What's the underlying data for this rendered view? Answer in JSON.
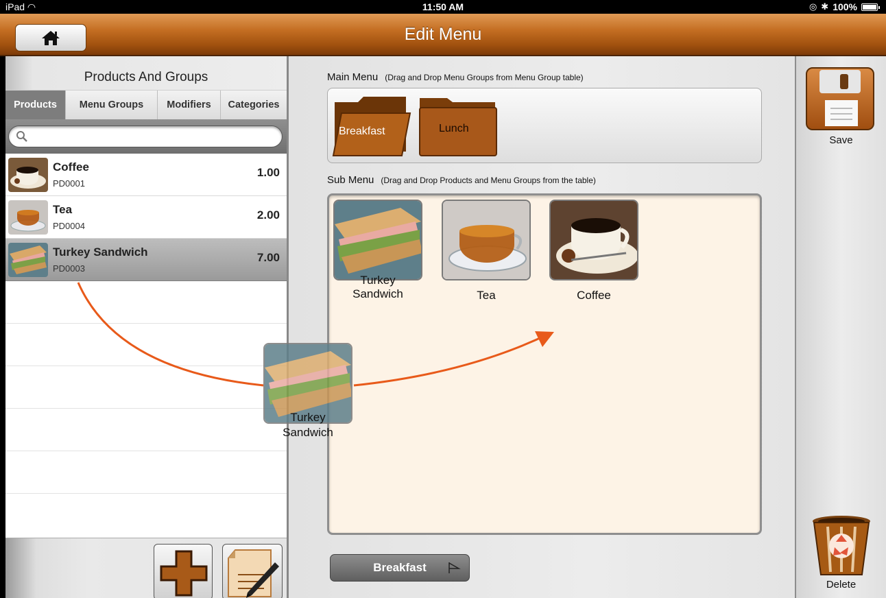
{
  "status_bar": {
    "device": "iPad",
    "time": "11:50 AM",
    "battery": "100%"
  },
  "header": {
    "title": "Edit Menu"
  },
  "left_panel": {
    "title": "Products And Groups",
    "tabs": [
      {
        "label": "Products",
        "active": true
      },
      {
        "label": "Menu Groups",
        "active": false
      },
      {
        "label": "Modifiers",
        "active": false
      },
      {
        "label": "Categories",
        "active": false
      }
    ],
    "search": {
      "placeholder": "",
      "value": ""
    },
    "products": [
      {
        "name": "Coffee",
        "code": "PD0001",
        "price": "1.00",
        "icon": "coffee-image"
      },
      {
        "name": "Tea",
        "code": "PD0004",
        "price": "2.00",
        "icon": "tea-image"
      },
      {
        "name": "Turkey Sandwich",
        "code": "PD0003",
        "price": "7.00",
        "icon": "sandwich-image",
        "selected": true
      }
    ]
  },
  "main_menu": {
    "label": "Main Menu",
    "hint": "(Drag and Drop Menu Groups from Menu Group table)",
    "groups": [
      {
        "label": "Breakfast",
        "open": true
      },
      {
        "label": "Lunch",
        "open": false
      }
    ]
  },
  "sub_menu": {
    "label": "Sub Menu",
    "hint": "(Drag and Drop Products and Menu Groups from the table)",
    "items": [
      {
        "caption_line1": "Turkey",
        "caption_line2": "Sandwich",
        "icon": "sandwich-image"
      },
      {
        "caption_line1": "Tea",
        "caption_line2": "",
        "icon": "tea-image"
      },
      {
        "caption_line1": "Coffee",
        "caption_line2": "",
        "icon": "coffee-image"
      }
    ]
  },
  "drag_preview": {
    "caption_line1": "Turkey",
    "caption_line2": "Sandwich"
  },
  "bottom_tab": {
    "label": "Breakfast"
  },
  "right_panel": {
    "save_label": "Save",
    "delete_label": "Delete"
  },
  "colors": {
    "brand_orange": "#c46e22",
    "arrow": "#e85a1a",
    "submenu_bg": "#fdf3e6"
  }
}
